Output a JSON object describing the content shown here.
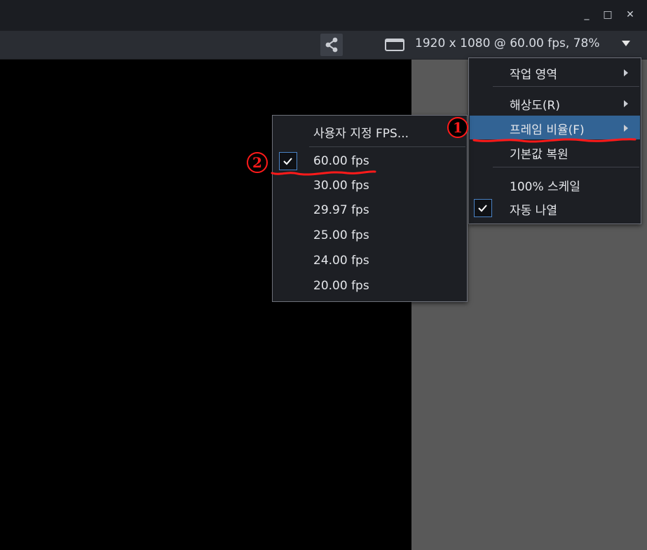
{
  "window": {
    "minimize": "_",
    "maximize": "□",
    "close": "✕"
  },
  "toolbar": {
    "resolution_label": "1920 x 1080 @ 60.00 fps, 78%",
    "share_icon": "share-icon",
    "monitor_icon": "monitor-icon",
    "dropdown_icon": "caret-down-icon"
  },
  "main_menu": {
    "items": [
      {
        "label": "작업 영역",
        "has_submenu": true,
        "checked": false
      },
      {
        "label": "해상도(R)",
        "has_submenu": true,
        "checked": false
      },
      {
        "label": "프레임 비율(F)",
        "has_submenu": true,
        "checked": false,
        "highlighted": true
      },
      {
        "label": "기본값 복원",
        "has_submenu": false,
        "checked": false
      },
      {
        "label": "100% 스케일",
        "has_submenu": false,
        "checked": false
      },
      {
        "label": "자동 나열",
        "has_submenu": false,
        "checked": true
      }
    ]
  },
  "fps_menu": {
    "items": [
      {
        "label": "사용자 지정 FPS...",
        "checked": false
      },
      {
        "label": "60.00 fps",
        "checked": true
      },
      {
        "label": "30.00 fps",
        "checked": false
      },
      {
        "label": "29.97 fps",
        "checked": false
      },
      {
        "label": "25.00 fps",
        "checked": false
      },
      {
        "label": "24.00 fps",
        "checked": false
      },
      {
        "label": "20.00 fps",
        "checked": false
      }
    ]
  },
  "annotations": {
    "step1": "1",
    "step2": "2",
    "color": "#ff1a1a"
  },
  "colors": {
    "highlight": "#326394",
    "menu_bg": "#1d1f24",
    "check_border": "#4a82c4"
  }
}
